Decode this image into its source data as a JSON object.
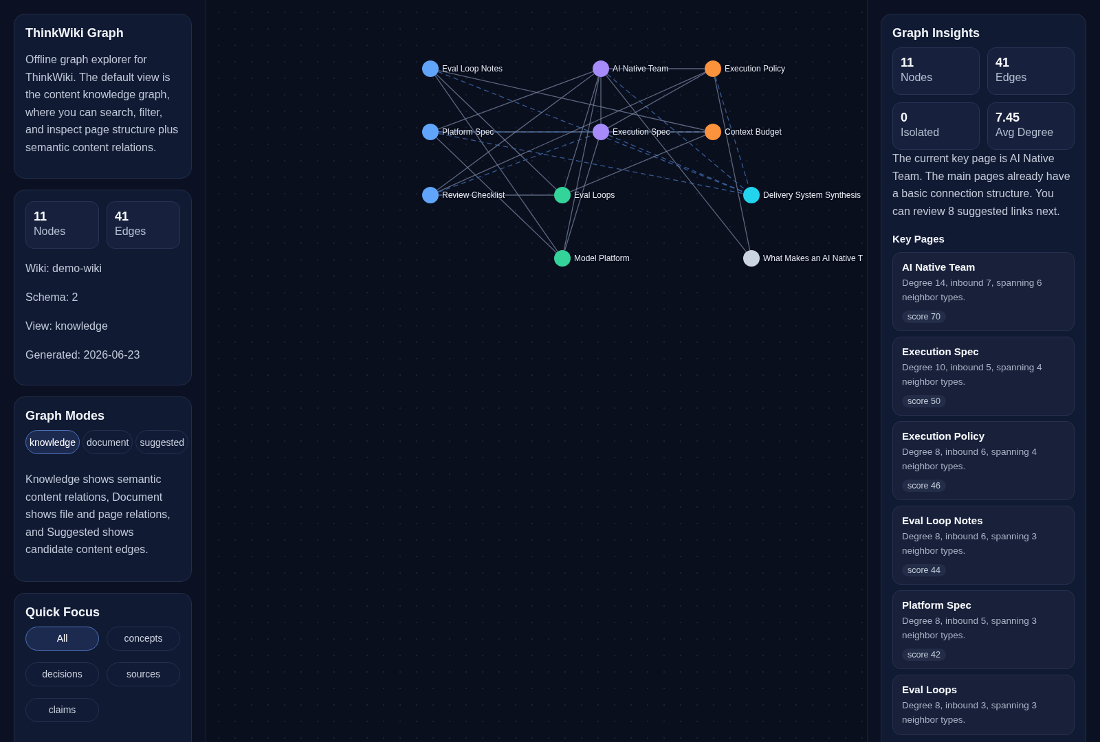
{
  "sidebar": {
    "about": {
      "title": "ThinkWiki Graph",
      "description": "Offline graph explorer for ThinkWiki. The default view is the content knowledge graph, where you can search, filter, and inspect page structure plus semantic content relations."
    },
    "overview": {
      "stats": [
        {
          "value": "11",
          "label": "Nodes"
        },
        {
          "value": "41",
          "label": "Edges"
        }
      ],
      "meta": [
        "Wiki: demo-wiki",
        "Schema: 2",
        "View: knowledge",
        "Generated: 2026-06-23"
      ]
    },
    "graph_modes": {
      "title": "Graph Modes",
      "modes": [
        {
          "label": "knowledge",
          "selected": true
        },
        {
          "label": "document",
          "selected": false
        },
        {
          "label": "suggested",
          "selected": false
        }
      ],
      "description": "Knowledge shows semantic content relations, Document shows file and page relations, and Suggested shows candidate content edges."
    },
    "quick_focus": {
      "title": "Quick Focus",
      "filters": [
        {
          "label": "All",
          "selected": true
        },
        {
          "label": "concepts",
          "selected": false
        },
        {
          "label": "decisions",
          "selected": false
        },
        {
          "label": "sources",
          "selected": false
        },
        {
          "label": "claims",
          "selected": false
        }
      ]
    }
  },
  "graph": {
    "nodes": [
      {
        "label": "Eval Loop Notes",
        "color": "#60a5fa"
      },
      {
        "label": "AI Native Team",
        "color": "#a78bfa"
      },
      {
        "label": "Execution Policy",
        "color": "#fb923c"
      },
      {
        "label": "Platform Spec",
        "color": "#60a5fa"
      },
      {
        "label": "Execution Spec",
        "color": "#a78bfa"
      },
      {
        "label": "Context Budget",
        "color": "#fb923c"
      },
      {
        "label": "Review Checklist",
        "color": "#60a5fa"
      },
      {
        "label": "Eval Loops",
        "color": "#34d399"
      },
      {
        "label": "Delivery System Synthesis",
        "color": "#22d3ee"
      },
      {
        "label": "Model Platform",
        "color": "#34d399"
      },
      {
        "label": "What Makes an AI Native T",
        "color": "#cbd5e1"
      }
    ]
  },
  "insights": {
    "title": "Graph Insights",
    "stats": [
      {
        "value": "11",
        "label": "Nodes"
      },
      {
        "value": "41",
        "label": "Edges"
      },
      {
        "value": "0",
        "label": "Isolated"
      },
      {
        "value": "7.45",
        "label": "Avg Degree"
      }
    ],
    "summary": "The current key page is AI Native Team. The main pages already have a basic connection structure. You can review 8 suggested links next.",
    "key_pages_title": "Key Pages",
    "key_pages": [
      {
        "title": "AI Native Team",
        "description": "Degree 14, inbound 7, spanning 6 neighbor types.",
        "score": "score 70"
      },
      {
        "title": "Execution Spec",
        "description": "Degree 10, inbound 5, spanning 4 neighbor types.",
        "score": "score 50"
      },
      {
        "title": "Execution Policy",
        "description": "Degree 8, inbound 6, spanning 4 neighbor types.",
        "score": "score 46"
      },
      {
        "title": "Eval Loop Notes",
        "description": "Degree 8, inbound 6, spanning 3 neighbor types.",
        "score": "score 44"
      },
      {
        "title": "Platform Spec",
        "description": "Degree 8, inbound 5, spanning 3 neighbor types.",
        "score": "score 42"
      },
      {
        "title": "Eval Loops",
        "description": "Degree 8, inbound 3, spanning 3 neighbor types."
      }
    ]
  }
}
